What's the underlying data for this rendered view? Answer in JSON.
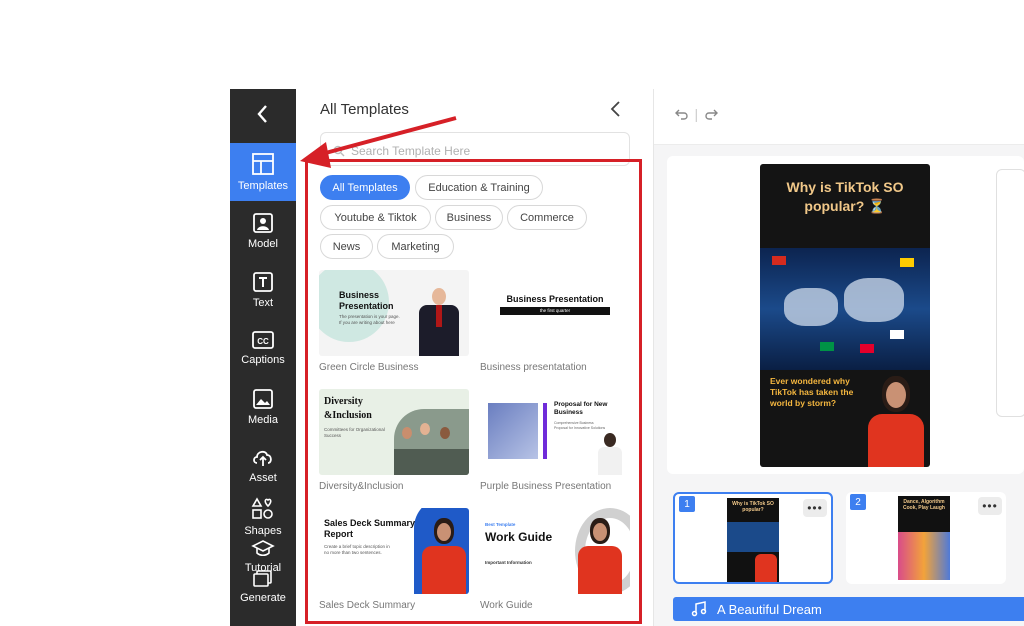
{
  "panel": {
    "title": "All Templates",
    "search_placeholder": "Search Template Here"
  },
  "nav": {
    "items": [
      {
        "label": "Templates",
        "icon": "templates-icon"
      },
      {
        "label": "Model",
        "icon": "model-icon"
      },
      {
        "label": "Text",
        "icon": "text-icon"
      },
      {
        "label": "Captions",
        "icon": "captions-icon"
      },
      {
        "label": "Media",
        "icon": "media-icon"
      },
      {
        "label": "Asset",
        "icon": "upload-icon"
      },
      {
        "label": "Shapes",
        "icon": "shapes-icon"
      },
      {
        "label": "Tutorial",
        "icon": "graduation-cap-icon"
      },
      {
        "label": "Generate",
        "icon": "generate-icon"
      }
    ]
  },
  "chips": [
    "All Templates",
    "Education & Training",
    "Youtube & Tiktok",
    "Business",
    "Commerce",
    "News",
    "Marketing"
  ],
  "templates": [
    {
      "label": "Green Circle Business",
      "thumb_title": "Business Presentation",
      "thumb_sub": "The presentation is your page. If you are writing about here"
    },
    {
      "label": "Business presentatation",
      "thumb_title": "Business Presentation",
      "thumb_sub": "the first quarter"
    },
    {
      "label": "Diversity&Inclusion",
      "thumb_title": "Diversity &Inclusion",
      "thumb_sub": "Committees for Organizational Success"
    },
    {
      "label": "Purple Business Presentation",
      "thumb_title": "Proposal for New Business",
      "thumb_sub": "Comprehensive Business Proposal for Innovative Solutions"
    },
    {
      "label": "Sales Deck Summary",
      "thumb_title": "Sales Deck Summary Report",
      "thumb_sub": "Create a brief topic description in no more than two sentences."
    },
    {
      "label": "Work Guide",
      "thumb_title": "Work Guide",
      "thumb_sub": "Important Information",
      "thumb_kicker": "Best Template"
    }
  ],
  "preview": {
    "headline": "Why is TikTok SO popular? ⏳",
    "caption": "Ever wondered why TikTok has taken the world by storm?",
    "cc_label": "CC"
  },
  "scenes": [
    {
      "num": "1",
      "title": "Why is TikTok SO popular?"
    },
    {
      "num": "2",
      "title": "Dance, Algorithm Cook, Play Laugh"
    }
  ],
  "music": {
    "title": "A Beautiful Dream"
  },
  "colors": {
    "accent": "#3d7ff0",
    "nav_bg": "#2b2b2b",
    "highlight": "#d62027"
  }
}
